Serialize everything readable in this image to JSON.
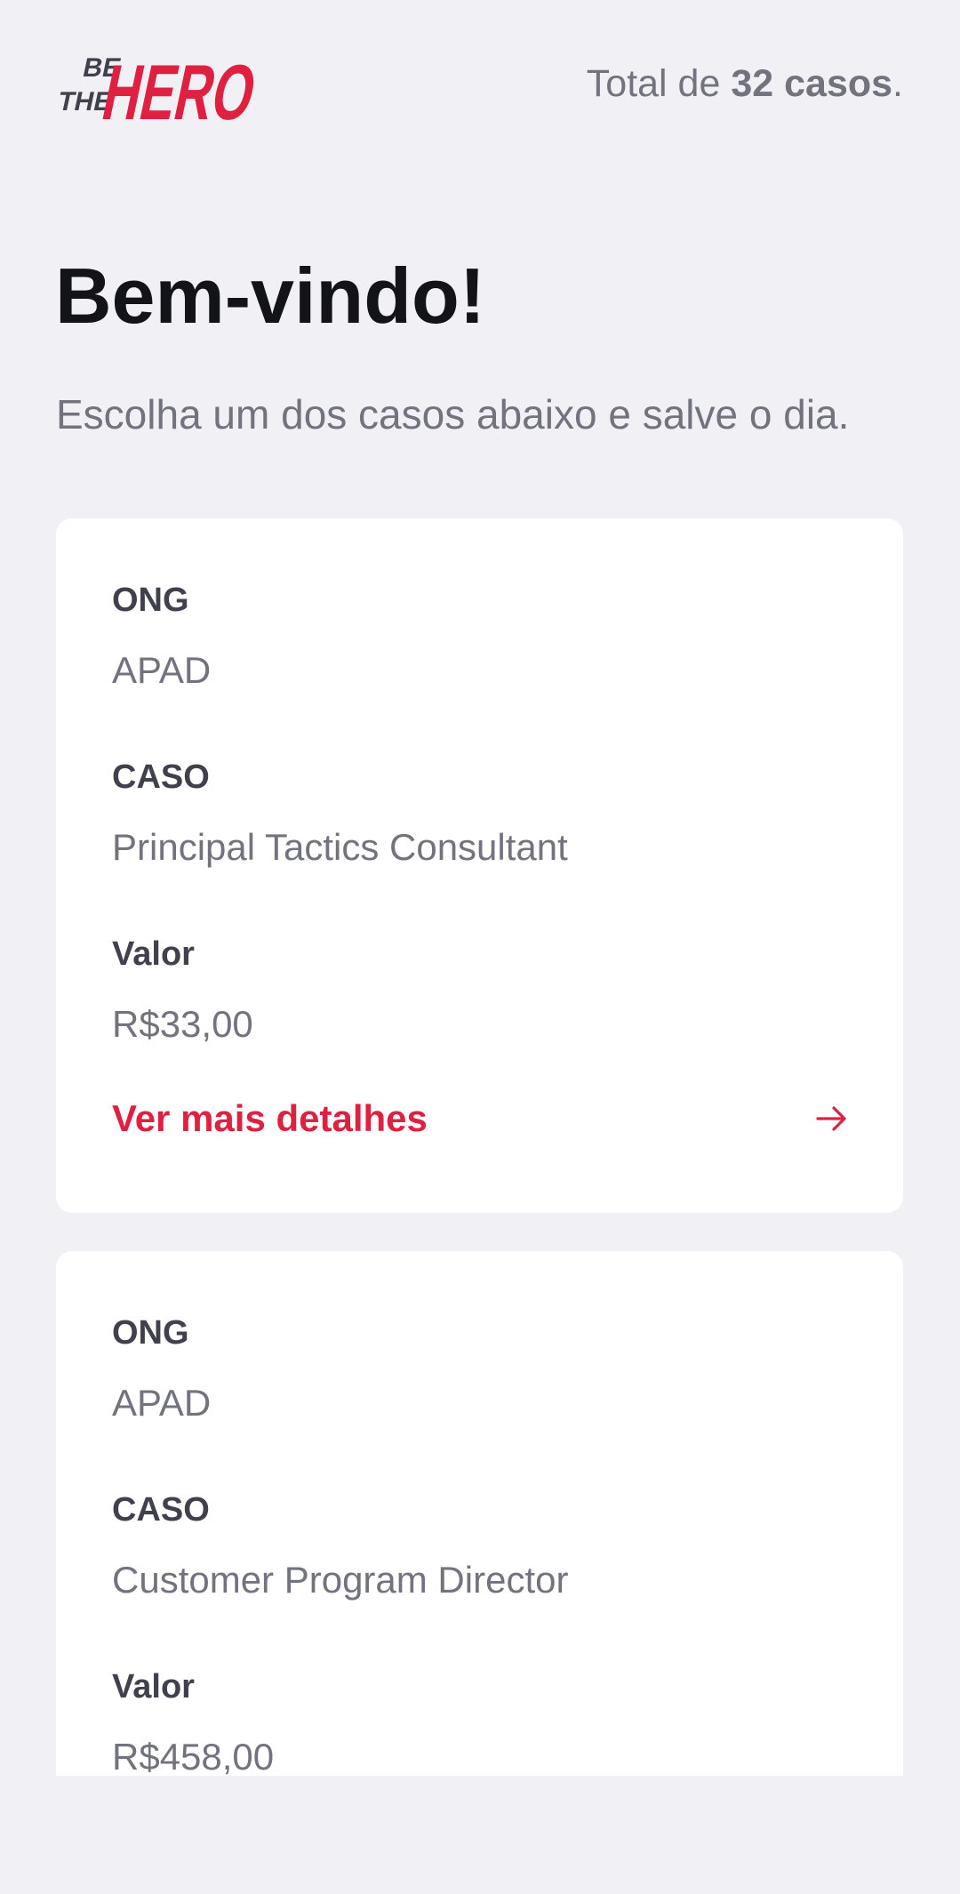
{
  "header": {
    "logo_text": [
      "BE",
      "THE",
      "HERO"
    ],
    "total_prefix": "Total de ",
    "total_count": "32 casos",
    "total_suffix": "."
  },
  "main": {
    "title": "Bem-vindo!",
    "description": "Escolha um dos casos abaixo e salve o dia."
  },
  "labels": {
    "ong": "ONG",
    "caso": "CASO",
    "valor": "Valor",
    "details_button": "Ver mais detalhes"
  },
  "incidents": [
    {
      "ong": "APAD",
      "caso": "Principal Tactics Consultant",
      "valor": "R$33,00"
    },
    {
      "ong": "APAD",
      "caso": "Customer Program Director",
      "valor": "R$458,00"
    }
  ],
  "icons": {
    "details_arrow": "arrow-right-icon"
  },
  "colors": {
    "background": "#f0f0f5",
    "accent": "#e02041",
    "title": "#13131a",
    "label": "#41414d",
    "muted": "#737380",
    "card": "#ffffff"
  }
}
